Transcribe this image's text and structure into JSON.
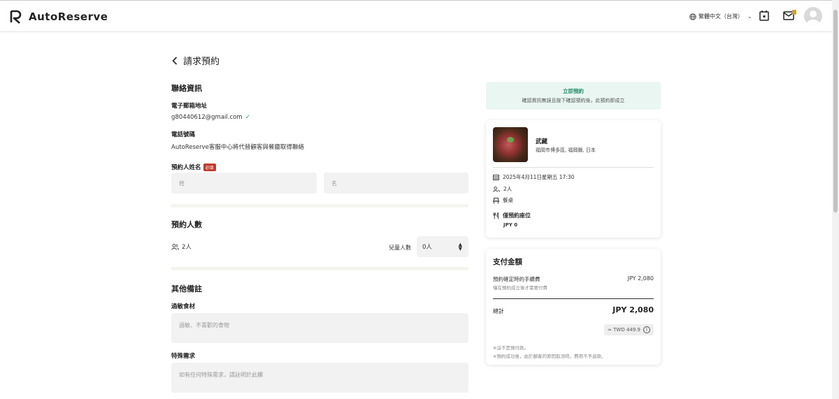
{
  "app": {
    "name": "AutoReserve"
  },
  "header": {
    "language": "繁體中文（台灣）",
    "icons": [
      "calendar-icon",
      "mail-icon",
      "avatar"
    ]
  },
  "page": {
    "title": "請求預約"
  },
  "contact": {
    "section_title": "聯絡資訊",
    "email_label": "電子郵箱地址",
    "email_value": "g80440612@gmail.com",
    "email_verified": "✓",
    "phone_label": "電話號碼",
    "phone_value": "AutoReserve客服中心將代替顧客與餐廳取得聯絡",
    "name_label": "預約人姓名",
    "name_required": "必填",
    "last_name_placeholder": "姓",
    "first_name_placeholder": "名"
  },
  "party": {
    "section_title": "預約人數",
    "people": "2人",
    "kids_label": "兒童人數",
    "kids_value": "0人"
  },
  "notes": {
    "section_title": "其他備註",
    "allergy_label": "過敏食材",
    "allergy_placeholder": "過敏、不喜歡的食物",
    "special_label": "特殊需求",
    "special_placeholder": "如有任何特殊需求，請註明於此欄"
  },
  "instant": {
    "title": "立即預約",
    "desc": "確認資訊無誤且按下確認預約後，此預約即成立"
  },
  "restaurant": {
    "name": "武藏",
    "location": "福岡市博多區, 福岡縣, 日本",
    "datetime": "2025年4月11日星期五 17:30",
    "people": "2人",
    "seat_type": "餐桌",
    "seat_only": "僅預約座位",
    "seat_price": "JPY 0"
  },
  "payment": {
    "title": "支付金額",
    "fee_label": "預約確定時的手續費",
    "fee_sub": "僅在預約成立後才需要付費",
    "fee_value": "JPY 2,080",
    "total_label": "總計",
    "total_value": "JPY 2,080",
    "twd_value": "≈ TWD 449.9",
    "info_glyph": "i",
    "note1": "※這不是預付款。",
    "note2": "※預約成功後，由於顧客的原因取消時，費用不予退款。"
  },
  "colors": {
    "accent_green": "#2a8f6e",
    "required_red": "#c0392b",
    "instant_bg": "#e9f6f2",
    "mail_badge": "#c9a437"
  }
}
